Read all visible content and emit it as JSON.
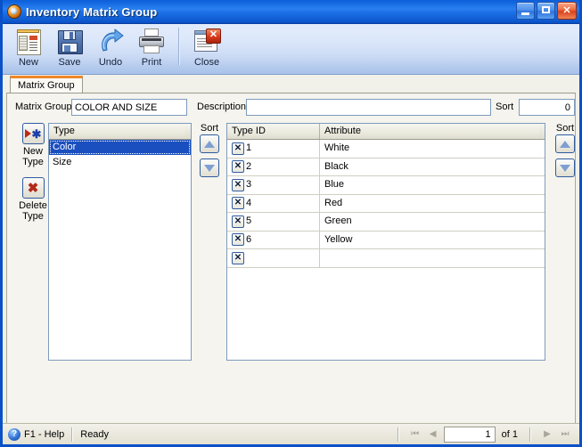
{
  "window": {
    "title": "Inventory Matrix Group",
    "title_icon": "app-globe-icon",
    "minimize_label": "",
    "maximize_label": "",
    "close_label": "✕"
  },
  "toolbar": {
    "items": [
      {
        "label": "New",
        "icon": "new-document-icon"
      },
      {
        "label": "Save",
        "icon": "floppy-disk-icon"
      },
      {
        "label": "Undo",
        "icon": "undo-arrow-icon"
      },
      {
        "label": "Print",
        "icon": "printer-icon"
      },
      {
        "label": "Close",
        "icon": "close-window-icon"
      }
    ]
  },
  "tabs": [
    {
      "label": "Matrix Group",
      "active": true
    }
  ],
  "header_fields": {
    "matrix_group_label": "Matrix Group",
    "matrix_group_value": "COLOR AND SIZE",
    "description_label": "Description",
    "description_value": "",
    "sort_label": "Sort",
    "sort_value": "0"
  },
  "side_buttons": [
    {
      "name": "new-type",
      "line1": "New",
      "line2": "Type",
      "icon": "new-record-arrow-asterisk-icon"
    },
    {
      "name": "delete-type",
      "line1": "Delete",
      "line2": "Type",
      "icon": "red-x-icon"
    }
  ],
  "type_grid": {
    "header": "Type",
    "rows": [
      {
        "label": "Color",
        "selected": true
      },
      {
        "label": "Size",
        "selected": false
      }
    ],
    "sort_label": "Sort",
    "sort_up": "▲",
    "sort_down": "▼"
  },
  "attribute_grid": {
    "headers": [
      "Type ID",
      "Attribute"
    ],
    "row_delete_glyph": "✕",
    "rows": [
      {
        "type_id": "1",
        "attribute": "White"
      },
      {
        "type_id": "2",
        "attribute": "Black"
      },
      {
        "type_id": "3",
        "attribute": "Blue"
      },
      {
        "type_id": "4",
        "attribute": "Red"
      },
      {
        "type_id": "5",
        "attribute": "Green"
      },
      {
        "type_id": "6",
        "attribute": "Yellow"
      },
      {
        "type_id": "",
        "attribute": ""
      }
    ],
    "sort_label": "Sort",
    "sort_up": "▲",
    "sort_down": "▼"
  },
  "statusbar": {
    "help_icon": "question-mark-icon",
    "help_text": "F1 - Help",
    "status_text": "Ready",
    "nav_first": "⏮",
    "nav_prev": "◀",
    "record_value": "1",
    "of_text": "of  1",
    "nav_next": "▶",
    "nav_last": "⏭"
  }
}
